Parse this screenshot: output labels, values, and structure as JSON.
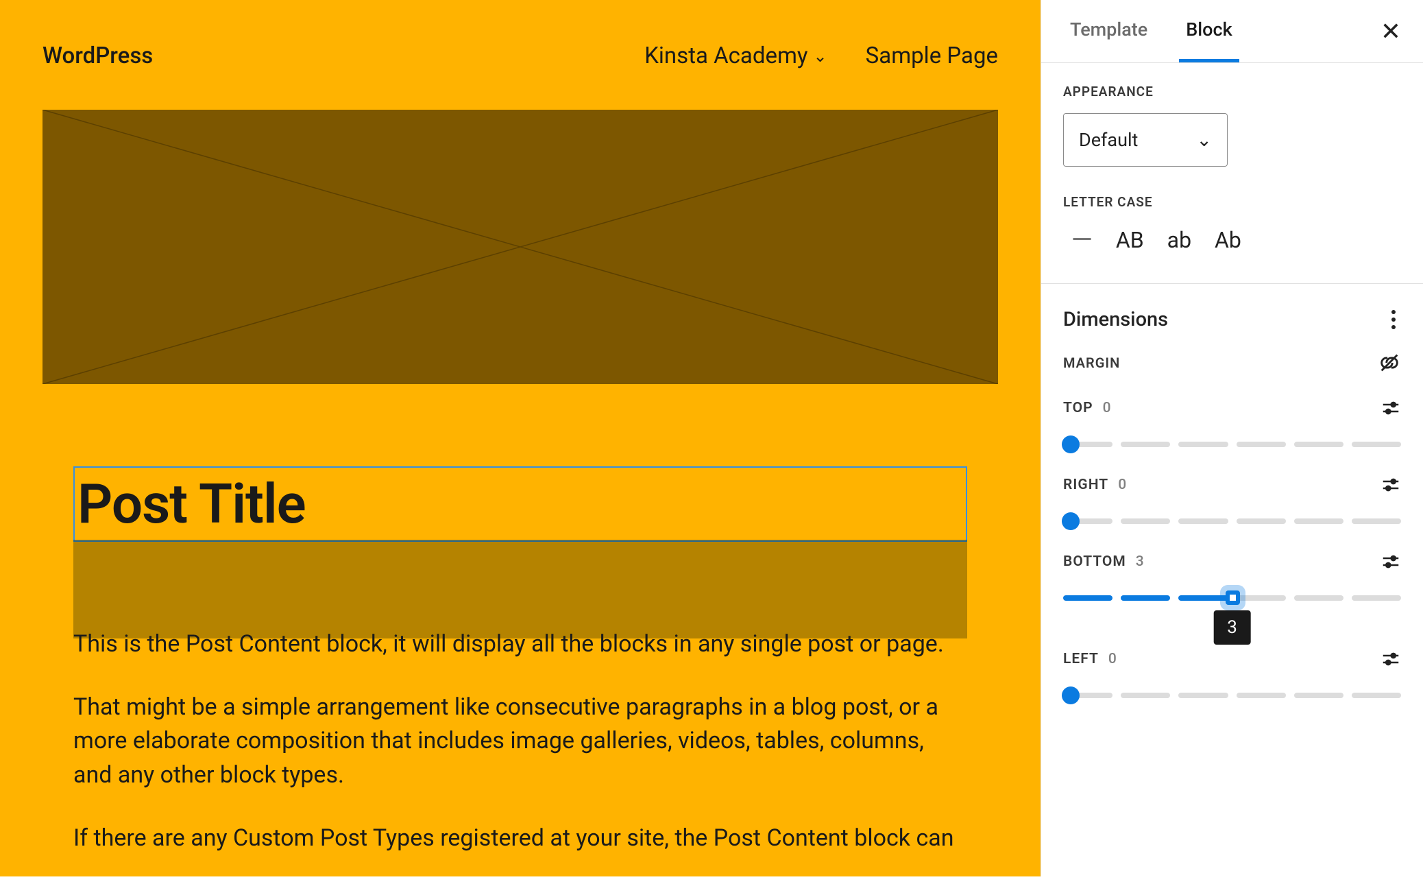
{
  "canvas": {
    "site_title": "WordPress",
    "nav": {
      "item1": "Kinsta Academy",
      "item2": "Sample Page"
    },
    "post_title": "Post Title",
    "body": {
      "p1": "This is the Post Content block, it will display all the blocks in any single post or page.",
      "p2": "That might be a simple arrangement like consecutive paragraphs in a blog post, or a more elaborate composition that includes image galleries, videos, tables, columns, and any other block types.",
      "p3": "If there are any Custom Post Types registered at your site, the Post Content block can"
    }
  },
  "sidebar": {
    "tabs": {
      "template": "Template",
      "block": "Block"
    },
    "appearance": {
      "label": "APPEARANCE",
      "value": "Default"
    },
    "letter_case": {
      "label": "LETTER CASE",
      "none": "—",
      "upper": "AB",
      "lower": "ab",
      "cap": "Ab"
    },
    "dimensions": {
      "label": "Dimensions",
      "margin_label": "MARGIN",
      "top": {
        "label": "TOP",
        "value": "0",
        "step": 0
      },
      "right": {
        "label": "RIGHT",
        "value": "0",
        "step": 0
      },
      "bottom": {
        "label": "BOTTOM",
        "value": "3",
        "step": 3,
        "tooltip": "3"
      },
      "left": {
        "label": "LEFT",
        "value": "0",
        "step": 0
      }
    }
  }
}
